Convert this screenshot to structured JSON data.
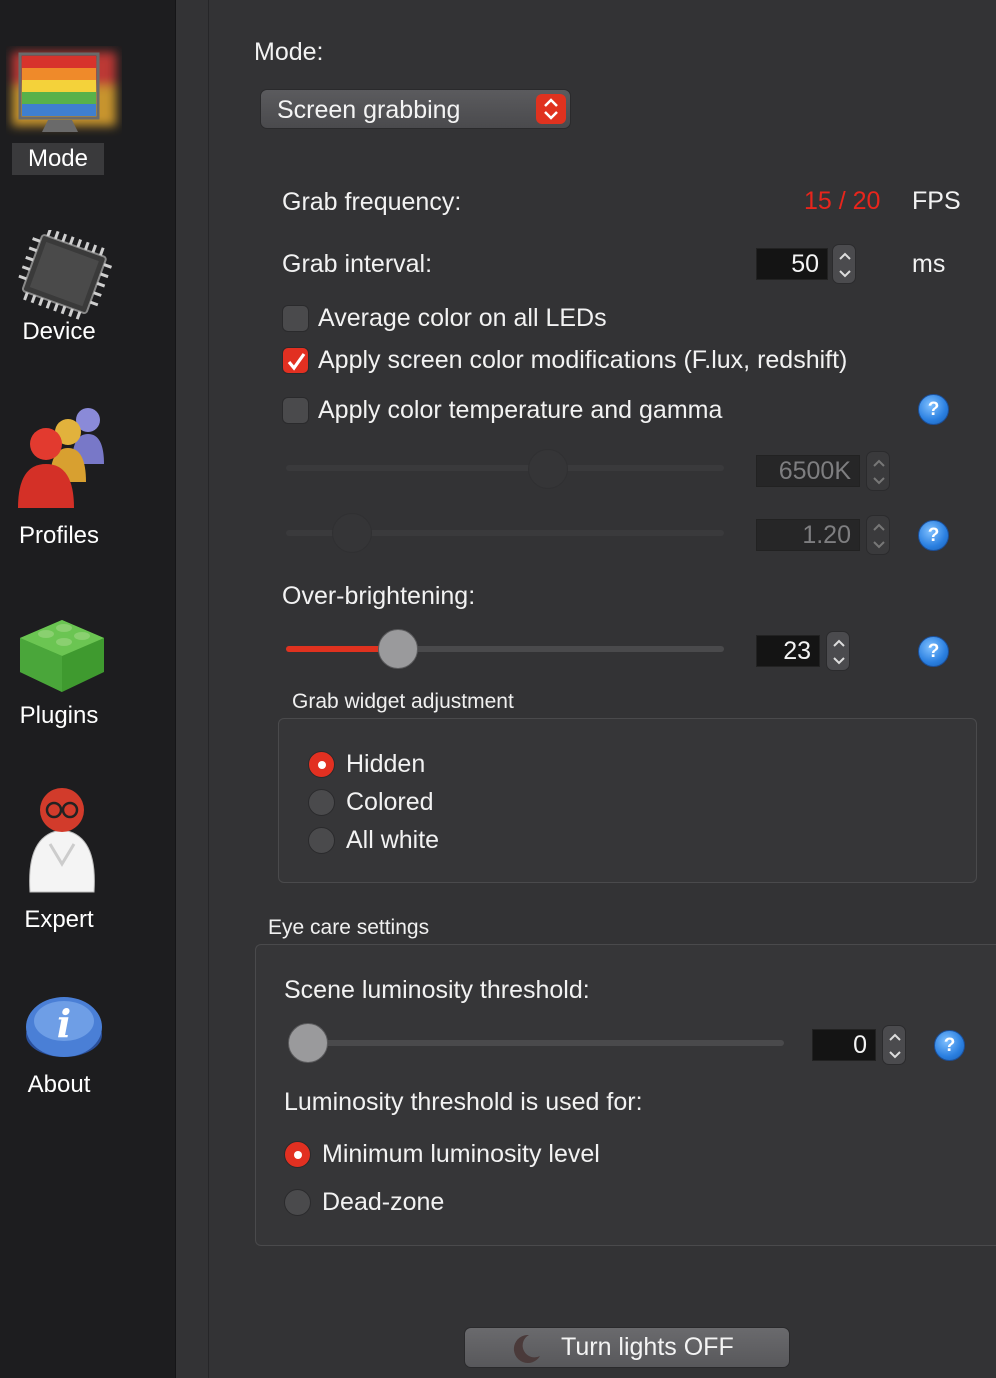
{
  "sidebar": {
    "items": [
      {
        "label": "Mode",
        "icon": "monitor-rainbow-icon"
      },
      {
        "label": "Device",
        "icon": "chip-icon"
      },
      {
        "label": "Profiles",
        "icon": "people-icon"
      },
      {
        "label": "Plugins",
        "icon": "lego-brick-icon"
      },
      {
        "label": "Expert",
        "icon": "scientist-icon"
      },
      {
        "label": "About",
        "icon": "info-icon"
      }
    ]
  },
  "mode": {
    "label": "Mode:",
    "selected": "Screen grabbing"
  },
  "grab": {
    "frequency_label": "Grab frequency:",
    "frequency_value": "15 / 20",
    "frequency_unit": "FPS",
    "interval_label": "Grab interval:",
    "interval_value": "50",
    "interval_unit": "ms"
  },
  "options": {
    "average_color": {
      "label": "Average color on all LEDs",
      "checked": false
    },
    "screen_mods": {
      "label": "Apply screen color modifications (F.lux, redshift)",
      "checked": true
    },
    "temp_gamma": {
      "label": "Apply color temperature and gamma",
      "checked": false
    }
  },
  "temperature": {
    "value": "6500K",
    "level": 0.6
  },
  "gamma": {
    "value": "1.20",
    "level": 0.15
  },
  "overbrightening": {
    "label": "Over-brightening:",
    "value": "23",
    "level": 0.23
  },
  "grab_widget": {
    "title": "Grab widget adjustment",
    "options": [
      "Hidden",
      "Colored",
      "All white"
    ],
    "selected": 0
  },
  "eye_care": {
    "title": "Eye care settings",
    "threshold_label": "Scene luminosity threshold:",
    "threshold_value": "0",
    "threshold_level": 0,
    "used_for_label": "Luminosity threshold is used for:",
    "options": [
      "Minimum luminosity level",
      "Dead-zone"
    ],
    "selected": 0
  },
  "lights_button": {
    "label": "Turn lights OFF",
    "icon": "moon-icon"
  },
  "help_icon": "?",
  "colors": {
    "accent": "#e0321f",
    "fps": "#e8251c",
    "help": "#2a7fe0"
  }
}
